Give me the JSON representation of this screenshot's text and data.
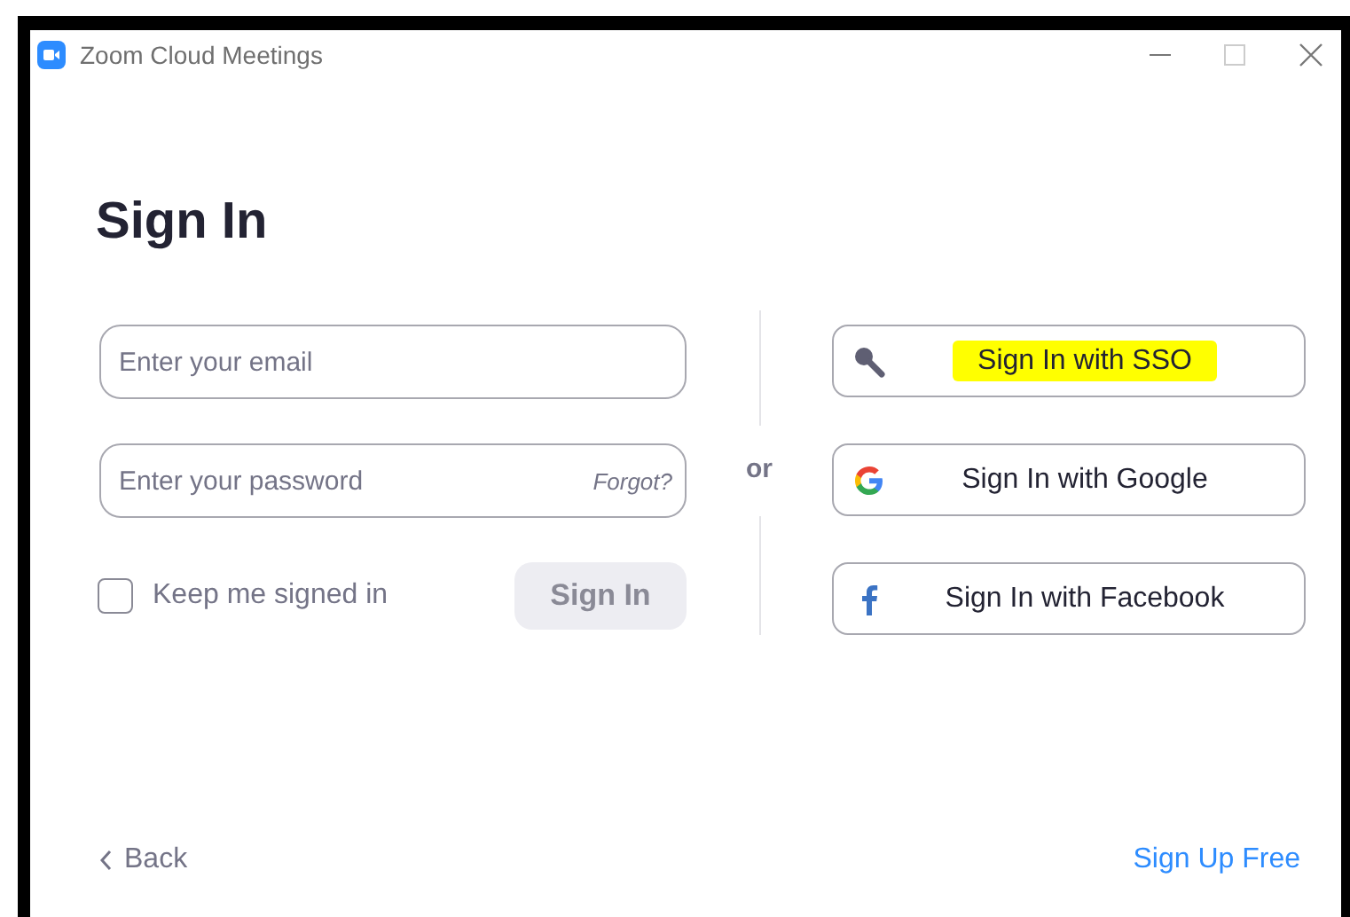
{
  "window": {
    "title": "Zoom Cloud Meetings"
  },
  "heading": "Sign In",
  "email_field": {
    "placeholder": "Enter your email"
  },
  "password_field": {
    "placeholder": "Enter your password",
    "link": "Forgot?"
  },
  "keep_signed_in": {
    "label": "Keep me signed in",
    "checked": false
  },
  "sign_in_button": {
    "label": "Sign In",
    "disabled": true
  },
  "separator": "or",
  "providers": [
    {
      "kind": "sso",
      "label": "Sign In with SSO",
      "highlighted": true
    },
    {
      "kind": "google",
      "label": "Sign In with Google",
      "highlighted": false
    },
    {
      "kind": "facebook",
      "label": "Sign In with Facebook",
      "highlighted": false
    }
  ],
  "back_link": "Back",
  "sign_up_link": "Sign Up Free"
}
